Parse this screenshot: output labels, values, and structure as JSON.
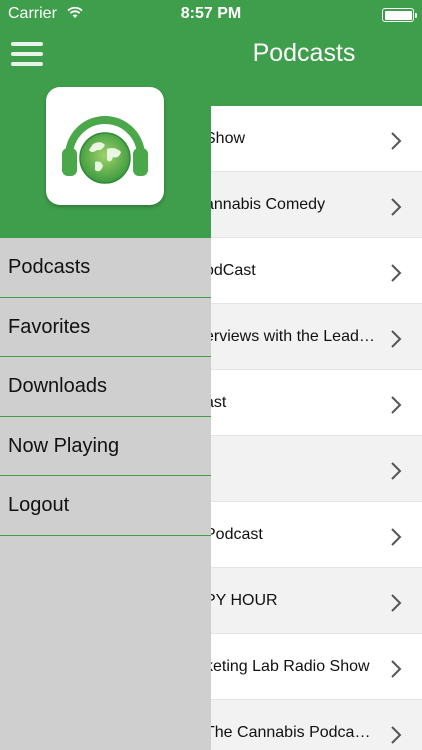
{
  "status_bar": {
    "carrier": "Carrier",
    "time": "8:57 PM"
  },
  "header": {
    "title": "Podcasts"
  },
  "menu": [
    {
      "label": "Podcasts"
    },
    {
      "label": "Favorites"
    },
    {
      "label": "Downloads"
    },
    {
      "label": "Now Playing"
    },
    {
      "label": "Logout"
    }
  ],
  "podcasts": [
    {
      "title": "Show"
    },
    {
      "title": "annabis Comedy"
    },
    {
      "title": "odCast"
    },
    {
      "title": "erviews with the Leaders of the Cannabis Industry"
    },
    {
      "title": "ast"
    },
    {
      "title": ""
    },
    {
      "title": " Podcast"
    },
    {
      "title": "PY HOUR"
    },
    {
      "title": "keting Lab Radio Show"
    },
    {
      "title": "The Cannabis Podcast Network"
    }
  ],
  "colors": {
    "brand_green": "#3f9e4c",
    "drawer_gray": "#cfcfcf"
  }
}
